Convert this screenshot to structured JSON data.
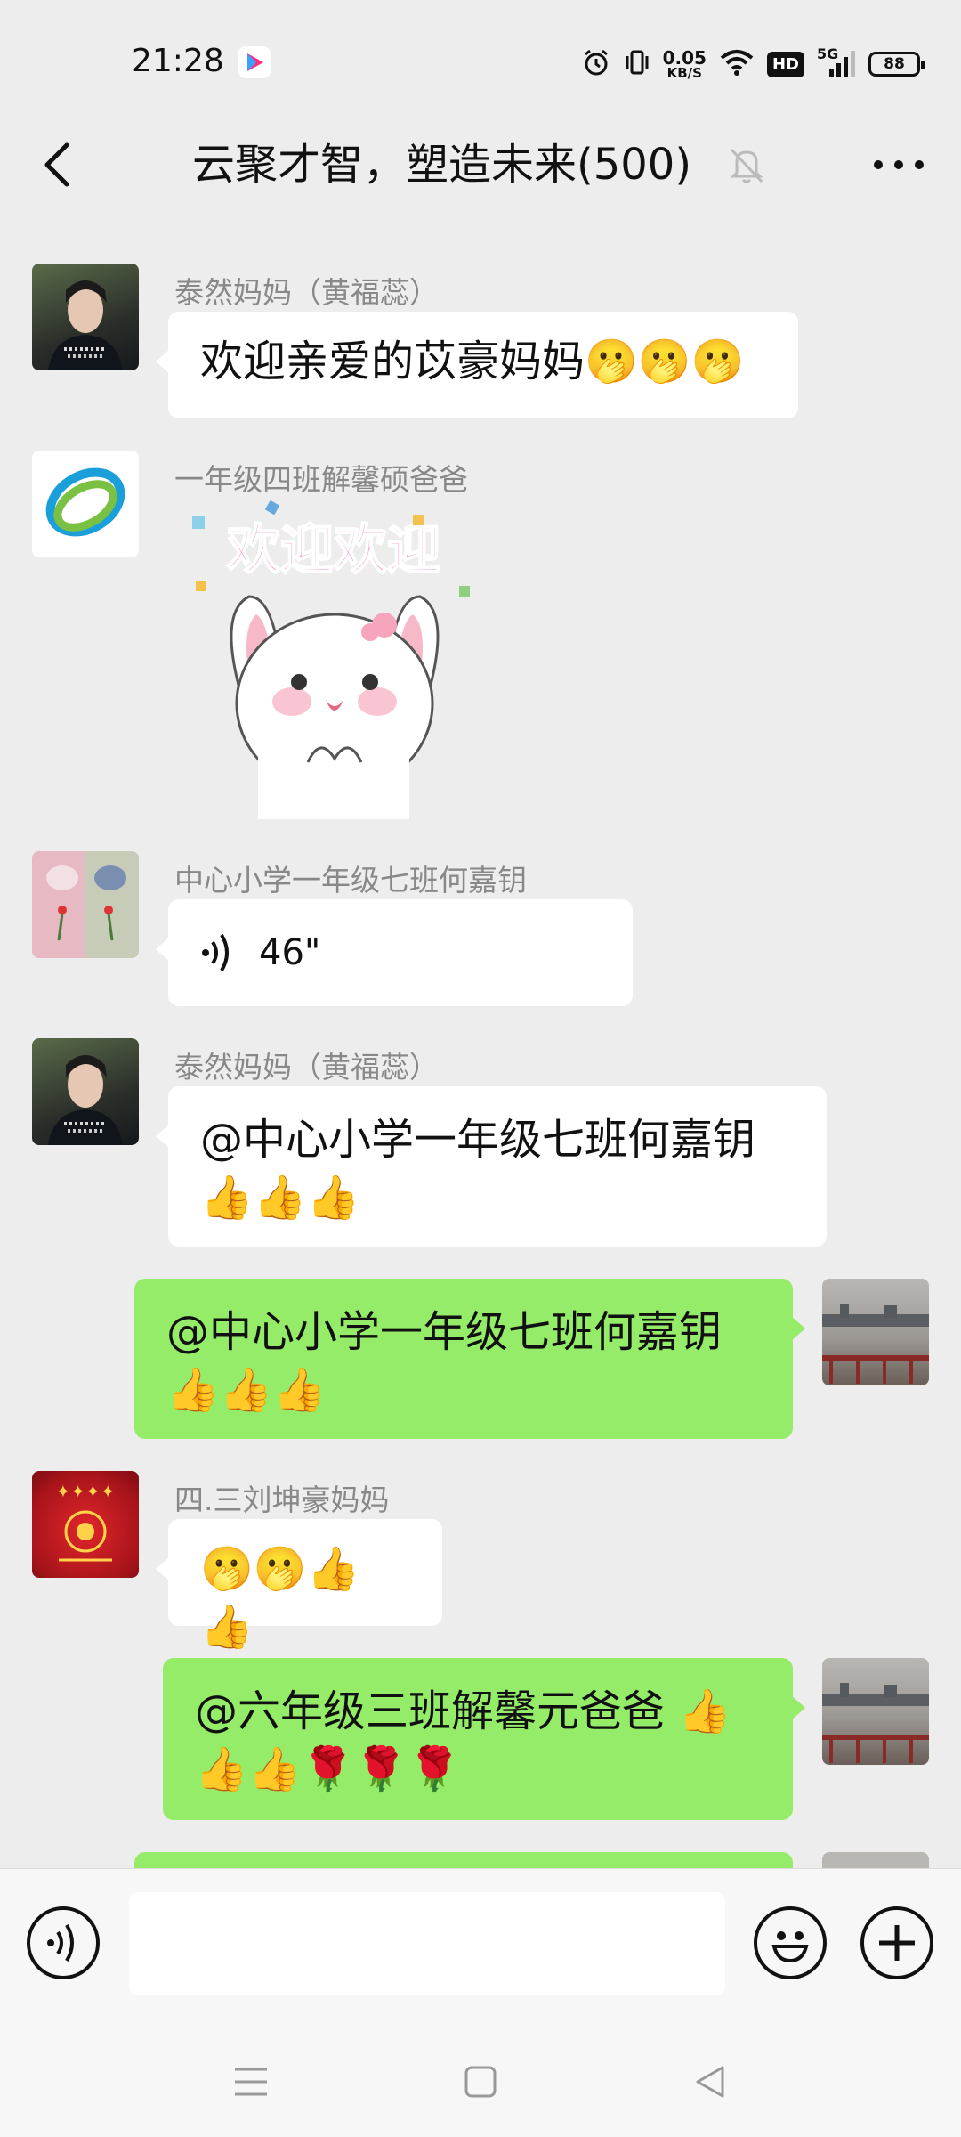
{
  "status_bar": {
    "time": "21:28",
    "net_speed_value": "0.05",
    "net_speed_unit": "KB/S",
    "hd_label": "HD",
    "network_label": "5G",
    "battery": "88",
    "icons": [
      "app-icon",
      "alarm-icon",
      "vibrate-icon",
      "wifi-icon",
      "signal-icon",
      "battery-icon"
    ]
  },
  "nav": {
    "title": "云聚才智，塑造未来(500)",
    "icons": [
      "back-icon",
      "muted-bell-icon",
      "more-icon"
    ]
  },
  "messages": [
    {
      "sender": "泰然妈妈（黄福蕊）",
      "text": "欢迎亲爱的苡豪妈妈",
      "emoji": "🫢🫢🫢"
    },
    {
      "sender": "一年级四班解馨硕爸爸",
      "sticker_text": "欢迎欢迎"
    },
    {
      "sender": "中心小学一年级七班何嘉钥",
      "voice_duration": "46\""
    },
    {
      "sender": "泰然妈妈（黄福蕊）",
      "text": "@中心小学一年级七班何嘉钥",
      "emoji": "👍👍👍"
    },
    {
      "sender": "",
      "text": "@中心小学一年级七班何嘉钥",
      "emoji": "👍👍👍"
    },
    {
      "sender": "四.三刘坤豪妈妈",
      "emoji": "🫢🫢👍👍"
    },
    {
      "sender": "",
      "text": "@六年级三班解馨元爸爸 👍",
      "emoji": "👍👍🌹🌹🌹"
    }
  ],
  "colors": {
    "background": "#ededed",
    "incoming_bubble": "#ffffff",
    "outgoing_bubble": "#95ec69",
    "sender_name": "#888888"
  }
}
